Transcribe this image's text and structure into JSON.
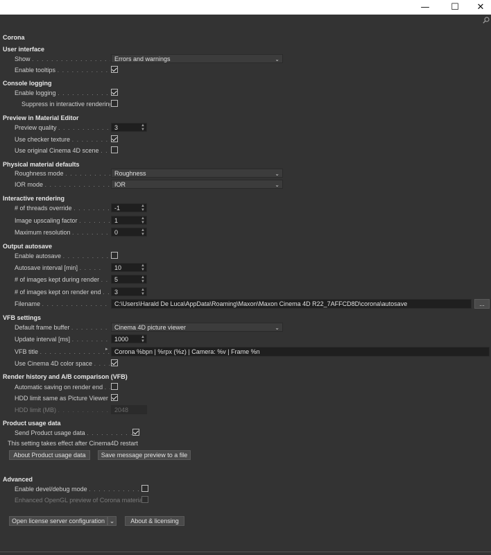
{
  "window": {
    "minimize_glyph": "—",
    "maximize_glyph": "☐",
    "close_glyph": "✕"
  },
  "icons": {
    "search": "search-icon"
  },
  "title": "Corona",
  "sections": {
    "user_interface": "User interface",
    "console_logging": "Console logging",
    "preview": "Preview in Material Editor",
    "physical": "Physical material defaults",
    "interactive": "Interactive rendering",
    "autosave": "Output autosave",
    "vfb": "VFB settings",
    "history": "Render history and A/B comparison (VFB)",
    "usage": "Product usage data",
    "advanced": "Advanced"
  },
  "ui": {
    "show_label": "Show",
    "show_value": "Errors and warnings",
    "tooltips_label": "Enable tooltips",
    "tooltips_checked": true
  },
  "console": {
    "logging_label": "Enable logging",
    "logging_checked": true,
    "suppress_label": "Suppress in interactive rendering",
    "suppress_checked": false
  },
  "preview": {
    "quality_label": "Preview quality",
    "quality_value": "3",
    "checker_label": "Use checker texture",
    "checker_checked": true,
    "scene_label": "Use original Cinema 4D scene",
    "scene_checked": false
  },
  "physical": {
    "roughness_label": "Roughness mode",
    "roughness_value": "Roughness",
    "ior_label": "IOR mode",
    "ior_value": "IOR"
  },
  "interactive": {
    "threads_label": "# of threads override",
    "threads_value": "-1",
    "upscale_label": "Image upscaling factor",
    "upscale_value": "1",
    "maxres_label": "Maximum resolution",
    "maxres_value": "0"
  },
  "autosave": {
    "enable_label": "Enable autosave",
    "enable_checked": false,
    "interval_label": "Autosave interval [min]",
    "interval_value": "10",
    "during_label": "# of images kept during render",
    "during_value": "5",
    "end_label": "# of images kept on render end",
    "end_value": "3",
    "filename_label": "Filename",
    "filename_value": "C:\\Users\\Harald De Luca\\AppData\\Roaming\\Maxon\\Maxon Cinema 4D R22_7AFFCD8D\\corona\\autosave",
    "browse_label": "..."
  },
  "vfb": {
    "buffer_label": "Default frame buffer",
    "buffer_value": "Cinema 4D picture viewer",
    "update_label": "Update interval [ms]",
    "update_value": "1000",
    "title_label": "VFB title",
    "title_value": "Corona %bpn | %rpx (%z) | Camera: %v | Frame %n",
    "colorspace_label": "Use Cinema 4D color space",
    "colorspace_checked": true
  },
  "history": {
    "autosave_label": "Automatic saving on render end",
    "autosave_checked": false,
    "hdd_same_label": "HDD limit same as Picture Viewer",
    "hdd_same_checked": true,
    "hdd_limit_label": "HDD limit (MB)",
    "hdd_limit_value": "2048"
  },
  "usage": {
    "send_label": "Send Product usage data",
    "send_checked": true,
    "note": "This setting takes effect after Cinema4D restart",
    "about_button": "About Product usage data",
    "save_button": "Save message preview to a file"
  },
  "advanced": {
    "devel_label": "Enable devel/debug mode",
    "devel_checked": false,
    "opengl_label": "Enhanced OpenGL preview of Corona materials",
    "opengl_checked": false
  },
  "footer": {
    "license_button": "Open license server configuration",
    "about_button": "About & licensing"
  }
}
